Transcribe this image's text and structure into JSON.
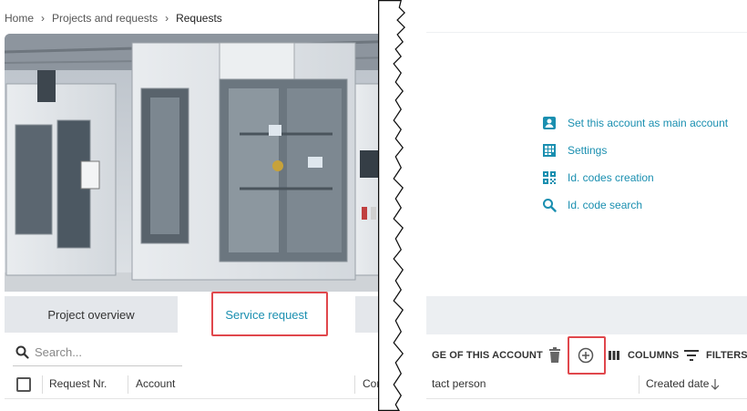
{
  "breadcrumb": {
    "items": [
      "Home",
      "Projects and requests",
      "Requests"
    ],
    "separator": "›"
  },
  "tabs": {
    "overview": "Project overview",
    "service": "Service request"
  },
  "search": {
    "placeholder": "Search..."
  },
  "table": {
    "left_columns": [
      "Request Nr.",
      "Account",
      "Compa"
    ],
    "right_columns": [
      "tact person",
      "Created date"
    ]
  },
  "menu": {
    "items": [
      {
        "label": "Set this account as main account",
        "icon": "account-badge-icon"
      },
      {
        "label": "Settings",
        "icon": "settings-grid-icon"
      },
      {
        "label": "Id. codes creation",
        "icon": "qr-code-icon"
      },
      {
        "label": "Id. code search",
        "icon": "search-icon"
      }
    ]
  },
  "toolbar": {
    "account_label": "GE OF THIS ACCOUNT",
    "columns_label": "COLUMNS",
    "filters_label": "FILTERS"
  },
  "colors": {
    "accent": "#1a8fb0",
    "highlight": "#e0474c",
    "tab_bg": "#e4e7eb"
  }
}
